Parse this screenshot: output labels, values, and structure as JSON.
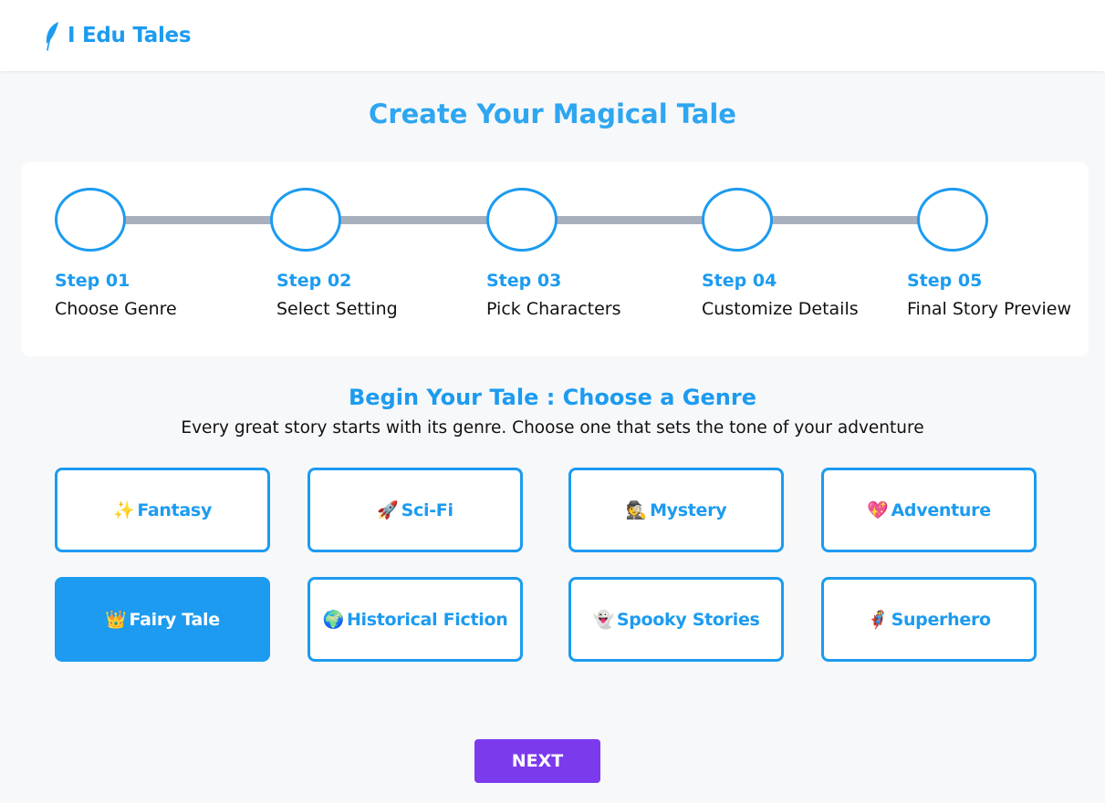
{
  "header": {
    "logo_icon": "feather-icon",
    "logo_text": "I Edu Tales"
  },
  "page_title": "Create Your Magical Tale",
  "steps": [
    {
      "num": "Step 01",
      "label": "Choose Genre"
    },
    {
      "num": "Step 02",
      "label": "Select Setting"
    },
    {
      "num": "Step 03",
      "label": "Pick Characters"
    },
    {
      "num": "Step 04",
      "label": "Customize Details"
    },
    {
      "num": "Step 05",
      "label": "Final Story Preview"
    }
  ],
  "section": {
    "title": "Begin Your Tale : Choose a Genre",
    "subtitle": "Every great story starts with its genre. Choose one that sets the tone of your adventure"
  },
  "genres": [
    {
      "icon": "sparkles-icon",
      "emoji": "✨",
      "label": "Fantasy",
      "selected": false
    },
    {
      "icon": "rocket-icon",
      "emoji": "🚀",
      "label": "Sci-Fi",
      "selected": false
    },
    {
      "icon": "detective-icon",
      "emoji": "🕵",
      "label": "Mystery",
      "selected": false
    },
    {
      "icon": "heart-icon",
      "emoji": "💖",
      "label": "Adventure",
      "selected": false
    },
    {
      "icon": "crown-icon",
      "emoji": "👑",
      "label": "Fairy Tale",
      "selected": true
    },
    {
      "icon": "globe-icon",
      "emoji": "🌍",
      "label": "Historical Fiction",
      "selected": false
    },
    {
      "icon": "ghost-icon",
      "emoji": "👻",
      "label": "Spooky Stories",
      "selected": false
    },
    {
      "icon": "superhero-icon",
      "emoji": "🦸",
      "label": "Superhero",
      "selected": false
    }
  ],
  "next_label": "NEXT",
  "colors": {
    "accent": "#1c9bf0",
    "title": "#2ea6f0",
    "next_button": "#7c3aed",
    "step_connector": "#a9b0bd"
  }
}
